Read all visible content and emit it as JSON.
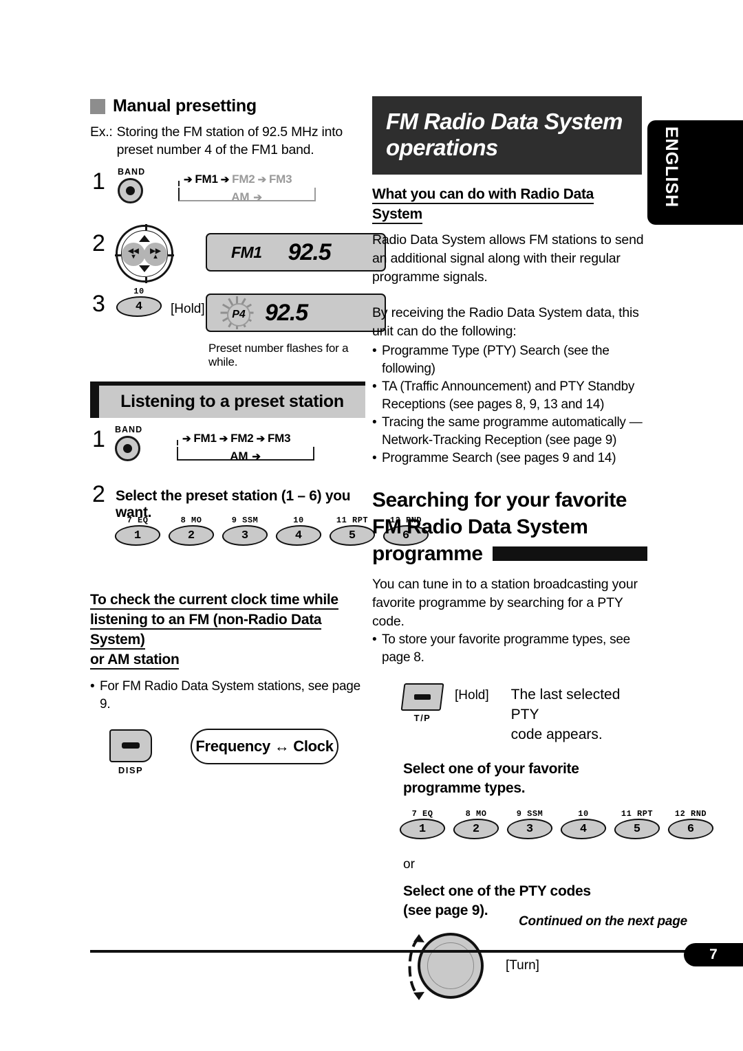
{
  "language_tab": "ENGLISH",
  "left": {
    "manual_presetting": {
      "heading": "Manual presetting",
      "example_label": "Ex.:",
      "example_text": "Storing the FM station of 92.5 MHz into preset number 4 of the FM1 band.",
      "step1": {
        "num": "1",
        "button_label": "BAND",
        "cycle": {
          "fm1": "FM1",
          "fm2": "FM2",
          "fm3": "FM3",
          "am": "AM"
        }
      },
      "step2": {
        "num": "2",
        "display": {
          "band": "FM1",
          "frequency": "92.5"
        }
      },
      "step3": {
        "num": "3",
        "key_top_label": "10",
        "key_label": "4",
        "hold": "[Hold]",
        "display": {
          "preset": "P4",
          "frequency": "92.5"
        },
        "caption": "Preset number flashes for a while."
      }
    },
    "listening_section": {
      "title": "Listening to a preset station",
      "step1": {
        "num": "1",
        "button_label": "BAND",
        "cycle": {
          "fm1": "FM1",
          "fm2": "FM2",
          "fm3": "FM3",
          "am": "AM"
        }
      },
      "step2": {
        "num": "2",
        "text": "Select the preset station (1 – 6) you want.",
        "keys": [
          {
            "top": "7  EQ",
            "label": "1"
          },
          {
            "top": "8  MO",
            "label": "2"
          },
          {
            "top": "9  SSM",
            "label": "3"
          },
          {
            "top": "10",
            "label": "4"
          },
          {
            "top": "11  RPT",
            "label": "5"
          },
          {
            "top": "12  RND",
            "label": "6"
          }
        ]
      }
    },
    "clock_check": {
      "heading_line1": "To check the current clock time while ",
      "heading_line2": "listening to an FM (non-Radio Data System) ",
      "heading_line3": "or AM station",
      "bullet": "For FM Radio Data System stations, see page 9.",
      "disp_button_label": "DISP",
      "pill_text": "Frequency ↔ Clock"
    }
  },
  "right": {
    "title_line1": "FM Radio Data System",
    "title_line2": "operations",
    "what_you_can_do": {
      "heading": "What you can do with Radio Data System",
      "paragraph1": "Radio Data System allows FM stations to send an additional signal along with their regular programme signals.",
      "paragraph2": "By receiving the Radio Data System data, this unit can do the following:",
      "bullets": [
        "Programme Type (PTY) Search (see the following)",
        "TA (Traffic Announcement) and PTY Standby Receptions (see pages 8, 9, 13 and 14)",
        "Tracing the same programme automatically —Network-Tracking Reception (see page 9)",
        "Programme Search (see pages 9 and 14)"
      ]
    },
    "searching": {
      "title_line1": "Searching for your favorite",
      "title_line2": "FM Radio Data System",
      "title_line3": "programme",
      "paragraph": "You can tune in to a station broadcasting your favorite programme by searching for a PTY code.",
      "bullet": "To store your favorite programme types, see page 8.",
      "step_tp": {
        "button_label": "T/P",
        "hold": "[Hold]",
        "result_line1": "The last selected PTY",
        "result_line2": "code appears."
      },
      "select_types_heading": "Select one of your favorite programme types.",
      "keys": [
        {
          "top": "7  EQ",
          "label": "1"
        },
        {
          "top": "8  MO",
          "label": "2"
        },
        {
          "top": "9  SSM",
          "label": "3"
        },
        {
          "top": "10",
          "label": "4"
        },
        {
          "top": "11  RPT",
          "label": "5"
        },
        {
          "top": "12  RND",
          "label": "6"
        }
      ],
      "or": "or",
      "select_pty_heading": "Select one of the PTY codes (see page 9).",
      "turn": "[Turn]"
    }
  },
  "footer": {
    "continued": "Continued on the next page",
    "page_number": "7"
  }
}
